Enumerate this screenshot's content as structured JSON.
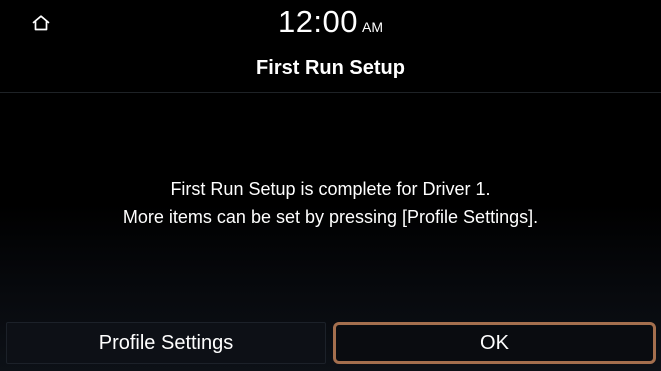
{
  "status_bar": {
    "home_icon": "home-icon",
    "time": "12:00",
    "ampm": "AM"
  },
  "header": {
    "title": "First Run Setup"
  },
  "message": {
    "line1": "First Run Setup is complete for Driver 1.",
    "line2": "More items can be set by pressing [Profile Settings]."
  },
  "buttons": {
    "profile_settings": "Profile Settings",
    "ok": "OK"
  },
  "colors": {
    "background": "#000000",
    "text": "#ffffff",
    "focus_border": "#a46f4e",
    "button_background": "#0d1016"
  }
}
